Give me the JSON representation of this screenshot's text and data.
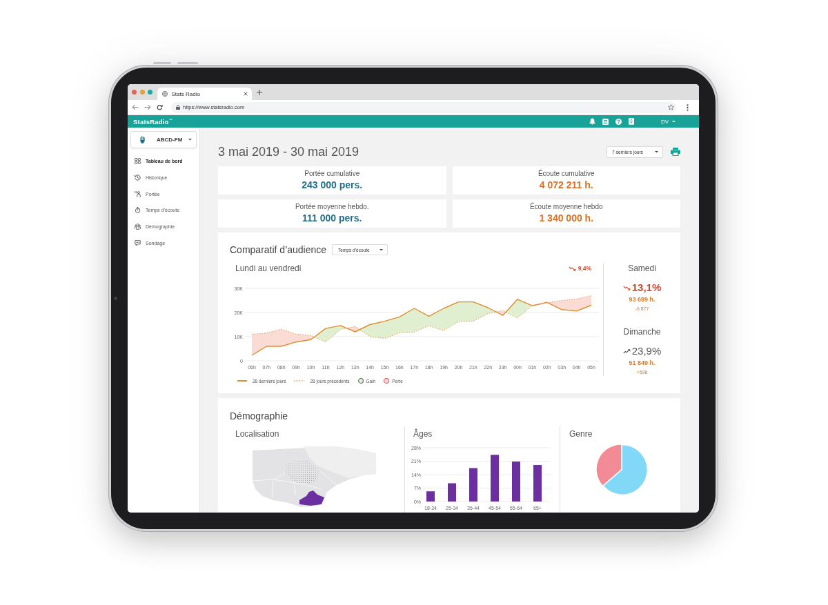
{
  "browser": {
    "tabs": [
      {
        "title": "Stats Radio",
        "selected": true
      }
    ],
    "url": "https://www.statsradio.com"
  },
  "app_bar": {
    "logo": "StatsRadio$^{™}$",
    "user": "DV"
  },
  "sidebar": {
    "station": "ABCD-FM",
    "items": [
      {
        "label": "Tableau de bord",
        "selected": true
      },
      {
        "label": "Historique",
        "selected": false
      },
      {
        "label": "Portée",
        "selected": false
      },
      {
        "label": "Temps d’écoute",
        "selected": false
      },
      {
        "label": "Démographie",
        "selected": false
      },
      {
        "label": "Sondage",
        "selected": false
      }
    ]
  },
  "page": {
    "period": "3 mai 2019 - 30 mai 2019",
    "range_select": "7 derniers jours"
  },
  "stats": [
    {
      "label": "Portée cumulative",
      "value": "243 000 pers.",
      "kind": "reach"
    },
    {
      "label": "Écoute cumulative",
      "value": "4 072 211 h.",
      "kind": "listening"
    },
    {
      "label": "Portée moyenne hebdo.",
      "value": "111 000 pers.",
      "kind": "reach"
    },
    {
      "label": "Écoute moyenne hebdo",
      "value": "1 340 000 h.",
      "kind": "listening"
    }
  ],
  "audience": {
    "title": "Comparatif d’audience",
    "metric_select": "Temps d’écoute",
    "weekdays": {
      "title": "Lundi au vendredi",
      "change": "9,4%",
      "rising": false,
      "chart_data": {
        "type": "line",
        "categories": [
          "06h",
          "07h",
          "08h",
          "09h",
          "10h",
          "11h",
          "12h",
          "13h",
          "14h",
          "15h",
          "16h",
          "17h",
          "18h",
          "19h",
          "20h",
          "21h",
          "22h",
          "23h",
          "00h",
          "01h",
          "02h",
          "03h",
          "04h",
          "05h"
        ],
        "ylim": [
          0,
          30000
        ],
        "yticks": [
          {
            "value": 0,
            "label": "0"
          },
          {
            "value": 10000,
            "label": "10K"
          },
          {
            "value": 20000,
            "label": "20K"
          },
          {
            "value": 30000,
            "label": "30K"
          }
        ],
        "grid": true,
        "series": [
          {
            "name": "28 derniers jours",
            "color": "#e08b2e",
            "line_style": "solid",
            "values": [
              2300,
              6000,
              6000,
              7800,
              8800,
              13400,
              14600,
              12000,
              15000,
              16400,
              18200,
              21700,
              18500,
              21700,
              24400,
              24400,
              22000,
              18800,
              25500,
              22800,
              24200,
              21200,
              20600,
              23000
            ]
          },
          {
            "name": "28 jours précédents",
            "color": "#e39a52",
            "line_style": "dashed",
            "values": [
              11000,
              11500,
              13100,
              11000,
              10500,
              7800,
              13000,
              14200,
              10000,
              9300,
              11600,
              11900,
              14500,
              12500,
              16200,
              16400,
              19600,
              20800,
              17700,
              23000,
              24000,
              25000,
              25600,
              27000
            ]
          }
        ]
      }
    },
    "area_legend": [
      {
        "label": "Gain",
        "kind": "gain",
        "color": "#dfefcf"
      },
      {
        "label": "Perte",
        "kind": "loss",
        "color": "#fadcd5"
      }
    ],
    "weekend": [
      {
        "day": "Samedi",
        "change": "13,1%",
        "rising": false,
        "hours": "93 689 h.",
        "delta": "-6 877"
      },
      {
        "day": "Dimanche",
        "change": "23,9%",
        "rising": true,
        "hours": "51 849 h.",
        "delta": "+598"
      }
    ]
  },
  "demographics": {
    "title": "Démographie",
    "location": {
      "title": "Localisation"
    },
    "ages": {
      "title": "Âges",
      "chart_data": {
        "type": "bar",
        "categories": [
          "18-24",
          "25-34",
          "35-44",
          "45-54",
          "55-64",
          "65+"
        ],
        "values": [
          5.3,
          9.5,
          17.4,
          24.3,
          20.8,
          19
        ],
        "ylim": [
          0,
          28
        ],
        "yticks": [
          {
            "value": 0,
            "label": "0%"
          },
          {
            "value": 7,
            "label": "7%"
          },
          {
            "value": 14,
            "label": "14%"
          },
          {
            "value": 21,
            "label": "21%"
          },
          {
            "value": 28,
            "label": "28%"
          }
        ],
        "grid": true
      }
    },
    "gender": {
      "title": "Genre"
    }
  }
}
